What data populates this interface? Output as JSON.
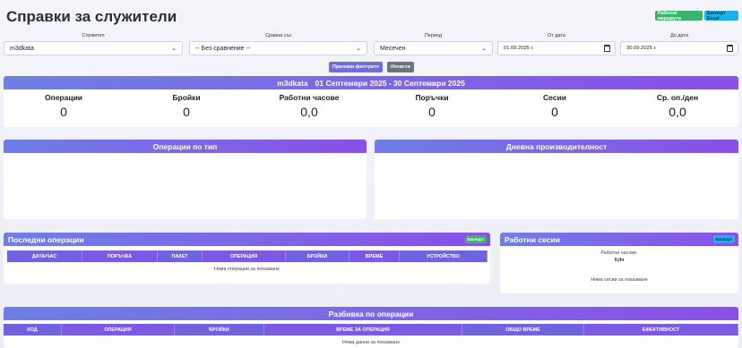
{
  "page": {
    "title": "Справки за служители"
  },
  "header_buttons": {
    "report": "Работни маршрути",
    "excel": "Експорт Excel"
  },
  "filters": {
    "employee": {
      "label": "Служител",
      "value": "m3dkata"
    },
    "compare": {
      "label": "Сравни със",
      "value": "-- Без сравнение --"
    },
    "period": {
      "label": "Период",
      "value": "Месечен"
    },
    "from_date": {
      "label": "От дата",
      "value": "01.09.2025 г."
    },
    "to_date": {
      "label": "До дата",
      "value": "30.09.2025 г."
    }
  },
  "actions": {
    "apply": "Приложи филтрите",
    "clear": "Изчисти"
  },
  "summary": {
    "employee": "m3dkata",
    "range": "01 Септември 2025 - 30 Септември 2025",
    "stats": [
      {
        "label": "Операции",
        "value": "0"
      },
      {
        "label": "Бройки",
        "value": "0"
      },
      {
        "label": "Работни часове",
        "value": "0,0"
      },
      {
        "label": "Поръчки",
        "value": "0"
      },
      {
        "label": "Сесии",
        "value": "0"
      },
      {
        "label": "Ср. оп./ден",
        "value": "0,0"
      }
    ]
  },
  "charts": {
    "by_type": "Операции по тип",
    "daily": "Дневна производителност"
  },
  "recent_ops": {
    "title": "Последни операции",
    "export": "Експорт",
    "columns": [
      "ДАТА/ЧАС",
      "ПОРЪЧКА",
      "ПАКЕТ",
      "ОПЕРАЦИЯ",
      "БРОЙКИ",
      "ВРЕМЕ",
      "УСТРОЙСТВО"
    ],
    "empty": "Няма операции за показване"
  },
  "sessions": {
    "title": "Работни сесии",
    "export": "Експорт",
    "hours_label": "Работни часове:",
    "hours_value": "0,0ч",
    "empty": "Няма сесии за показване"
  },
  "breakdown": {
    "title": "Разбивка по операции",
    "columns": [
      "КОД",
      "ОПЕРАЦИЯ",
      "БРОЙКИ",
      "ВРЕМЕ ЗА ОПЕРАЦИЯ",
      "ОБЩО ВРЕМЕ",
      "ЕФЕКТИВНОСТ"
    ],
    "empty": "Няма данни за показване"
  },
  "colors": {
    "accent_start": "#6f7fe4",
    "accent_end": "#8a4fe8",
    "success": "#3bb56b",
    "info": "#1cb1ec"
  }
}
